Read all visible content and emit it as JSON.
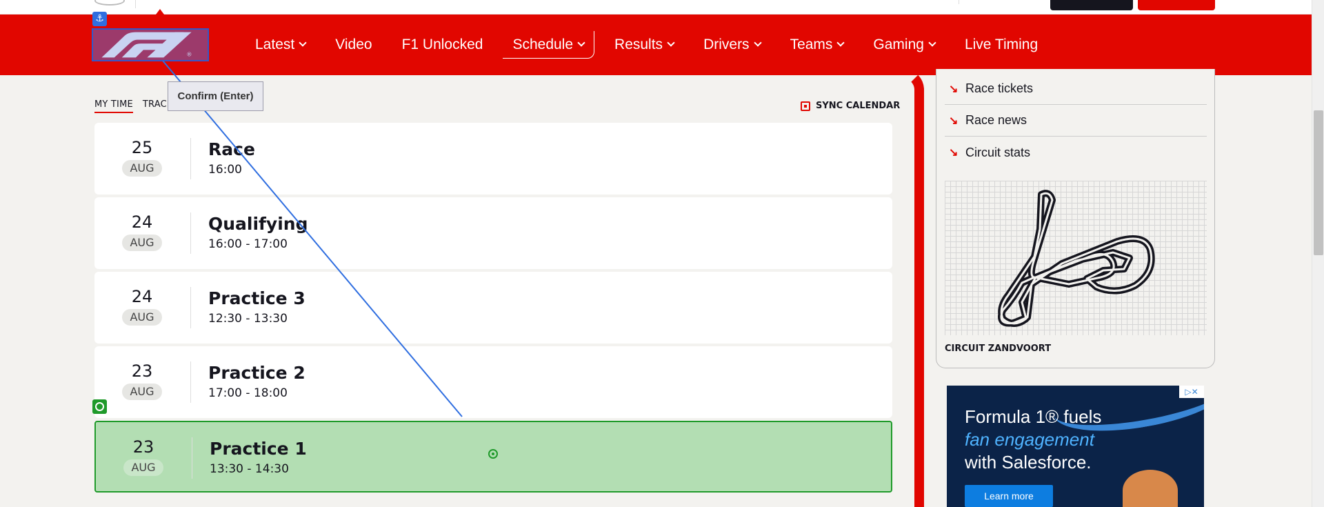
{
  "nav": {
    "items": [
      {
        "label": "Latest",
        "dropdown": true
      },
      {
        "label": "Video",
        "dropdown": false
      },
      {
        "label": "F1 Unlocked",
        "dropdown": false
      },
      {
        "label": "Schedule",
        "dropdown": true,
        "active": true
      },
      {
        "label": "Results",
        "dropdown": true
      },
      {
        "label": "Drivers",
        "dropdown": true
      },
      {
        "label": "Teams",
        "dropdown": true
      },
      {
        "label": "Gaming",
        "dropdown": true
      },
      {
        "label": "Live Timing",
        "dropdown": false
      }
    ]
  },
  "tabs": {
    "my_time": "MY TIME",
    "track": "TRAC"
  },
  "sync_calendar": "SYNC CALENDAR",
  "tooltip": "Confirm (Enter)",
  "sessions": [
    {
      "day": "25",
      "month": "AUG",
      "name": "Race",
      "time": "16:00"
    },
    {
      "day": "24",
      "month": "AUG",
      "name": "Qualifying",
      "time": "16:00 - 17:00"
    },
    {
      "day": "24",
      "month": "AUG",
      "name": "Practice 3",
      "time": "12:30 - 13:30"
    },
    {
      "day": "23",
      "month": "AUG",
      "name": "Practice 2",
      "time": "17:00 - 18:00"
    },
    {
      "day": "23",
      "month": "AUG",
      "name": "Practice 1",
      "time": "13:30 - 14:30"
    }
  ],
  "sidebar": {
    "links": [
      "Race tickets",
      "Race news",
      "Circuit stats"
    ],
    "circuit_name": "CIRCUIT ZANDVOORT"
  },
  "ad": {
    "line1": "Formula 1® fuels",
    "line2": "fan engagement",
    "line3": "with Salesforce.",
    "cta": "Learn more"
  },
  "colors": {
    "brand_red": "#e10600",
    "highlight_green": "#b3deb3",
    "annotation_blue": "#2f6ee0"
  }
}
